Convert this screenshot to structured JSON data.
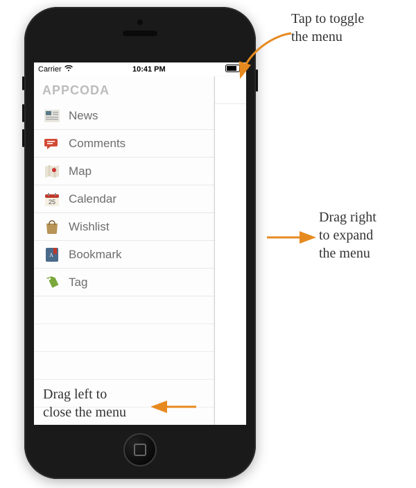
{
  "statusbar": {
    "carrier": "Carrier",
    "time": "10:41 PM"
  },
  "brand": "APPCODA",
  "menu": {
    "items": [
      {
        "label": "News",
        "icon": "news-icon"
      },
      {
        "label": "Comments",
        "icon": "comments-icon"
      },
      {
        "label": "Map",
        "icon": "map-icon"
      },
      {
        "label": "Calendar",
        "icon": "calendar-icon"
      },
      {
        "label": "Wishlist",
        "icon": "wishlist-icon"
      },
      {
        "label": "Bookmark",
        "icon": "bookmark-icon"
      },
      {
        "label": "Tag",
        "icon": "tag-icon"
      }
    ]
  },
  "annotations": {
    "toggle": "Tap to toggle\nthe menu",
    "expand": "Drag right\nto expand\nthe menu",
    "close": "Drag left to\nclose the menu"
  },
  "colors": {
    "arrow": "#e68a1f"
  }
}
